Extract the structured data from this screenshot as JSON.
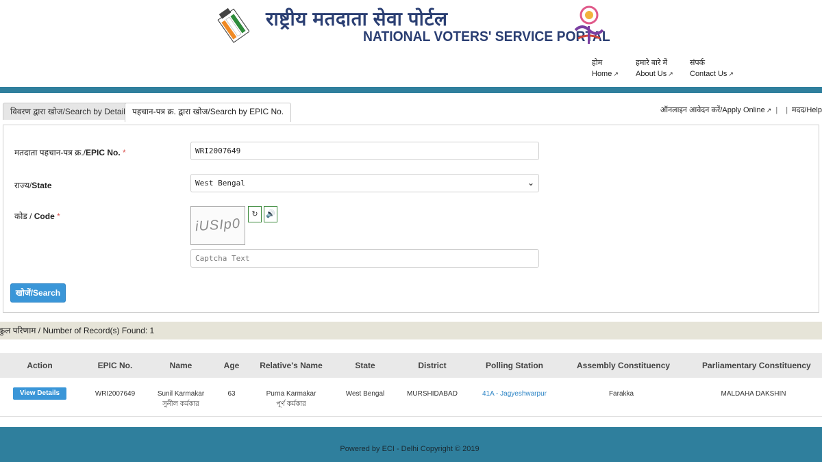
{
  "header": {
    "title_hindi": "राष्ट्रीय मतदाता सेवा पोर्टल",
    "title_english": "NATIONAL VOTERS' SERVICE PORTAL",
    "nav": [
      {
        "hindi": "होम",
        "english": "Home"
      },
      {
        "hindi": "हमारे बारे में",
        "english": "About Us"
      },
      {
        "hindi": "संपर्क",
        "english": "Contact Us"
      }
    ]
  },
  "tabs": [
    {
      "label": "विवरण द्वारा खोज/Search by Details",
      "active": false
    },
    {
      "label": "पहचान-पत्र क्र. द्वारा खोज/Search by EPIC No.",
      "active": true
    }
  ],
  "right_links": {
    "apply_online": "ऑनलाइन आवेदन करें/Apply Online",
    "help": "मदद/Help"
  },
  "form": {
    "epic_label_hindi": "मतदाता पहचान-पत्र क्र./",
    "epic_label_english": "EPIC No.",
    "epic_value": "WRI2007649",
    "state_label_hindi": "राज्य/",
    "state_label_english": "State",
    "state_value": "West Bengal",
    "code_label_hindi": "कोड / ",
    "code_label_english": "Code",
    "required_mark": "*",
    "captcha_image_text": "iUSIp0",
    "captcha_placeholder": "Captcha Text",
    "search_button": "खोजें/Search"
  },
  "records": {
    "summary": "कुल परिणाम / Number of Record(s) Found: 1"
  },
  "table": {
    "columns": [
      "Action",
      "EPIC No.",
      "Name",
      "Age",
      "Relative's Name",
      "State",
      "District",
      "Polling Station",
      "Assembly Constituency",
      "Parliamentary Constituency"
    ],
    "rows": [
      {
        "action": "View Details",
        "epic": "WRI2007649",
        "name_en": "Sunil Karmakar",
        "name_bn": "সুনীল কর্মকার",
        "age": "63",
        "relative_en": "Purna Karmakar",
        "relative_bn": "পূর্ণ কর্মকার",
        "state": "West Bengal",
        "district": "MURSHIDABAD",
        "polling_station": "41A - Jagyeshwarpur",
        "assembly": "Farakka",
        "parliamentary": "MALDAHA DAKSHIN"
      }
    ]
  },
  "footer": {
    "text": "Powered by ECI - Delhi Copyright © 2019"
  },
  "colors": {
    "teal": "#2f7f9d",
    "button_blue": "#3a96d8",
    "title_navy": "#2b3f73",
    "records_bar": "#e6e4d8"
  },
  "icons": [
    "eci-logo-icon",
    "tyohar-logo-icon",
    "external-link-icon",
    "refresh-icon",
    "speaker-icon",
    "chevron-down-icon"
  ]
}
